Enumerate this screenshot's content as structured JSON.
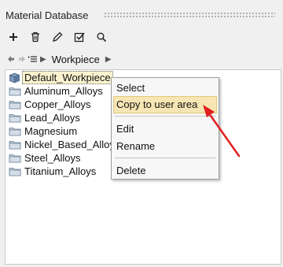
{
  "panel": {
    "title": "Material Database"
  },
  "toolbar": [
    {
      "name": "add-button",
      "icon": "plus-icon"
    },
    {
      "name": "delete-button",
      "icon": "trash-icon"
    },
    {
      "name": "edit-button",
      "icon": "pencil-icon"
    },
    {
      "name": "check-button",
      "icon": "checkbox-icon"
    },
    {
      "name": "search-button",
      "icon": "search-icon"
    }
  ],
  "path": {
    "current": "Workpiece"
  },
  "tree": {
    "items": [
      {
        "label": "Default_Workpiece",
        "icon": "material-cube-icon",
        "selected": true
      },
      {
        "label": "Aluminum_Alloys",
        "icon": "folder-icon"
      },
      {
        "label": "Copper_Alloys",
        "icon": "folder-icon"
      },
      {
        "label": "Lead_Alloys",
        "icon": "folder-icon"
      },
      {
        "label": "Magnesium",
        "icon": "folder-icon"
      },
      {
        "label": "Nickel_Based_Alloys",
        "icon": "folder-icon"
      },
      {
        "label": "Steel_Alloys",
        "icon": "folder-icon"
      },
      {
        "label": "Titanium_Alloys",
        "icon": "folder-icon"
      }
    ]
  },
  "context_menu": {
    "items": [
      {
        "label": "Select"
      },
      {
        "label": "Copy to user area",
        "highlighted": true
      },
      {
        "label": "Edit"
      },
      {
        "label": "Rename"
      },
      {
        "label": "Delete"
      }
    ]
  },
  "colors": {
    "highlight": "#f7e6b3",
    "arrow": "#e02020"
  }
}
